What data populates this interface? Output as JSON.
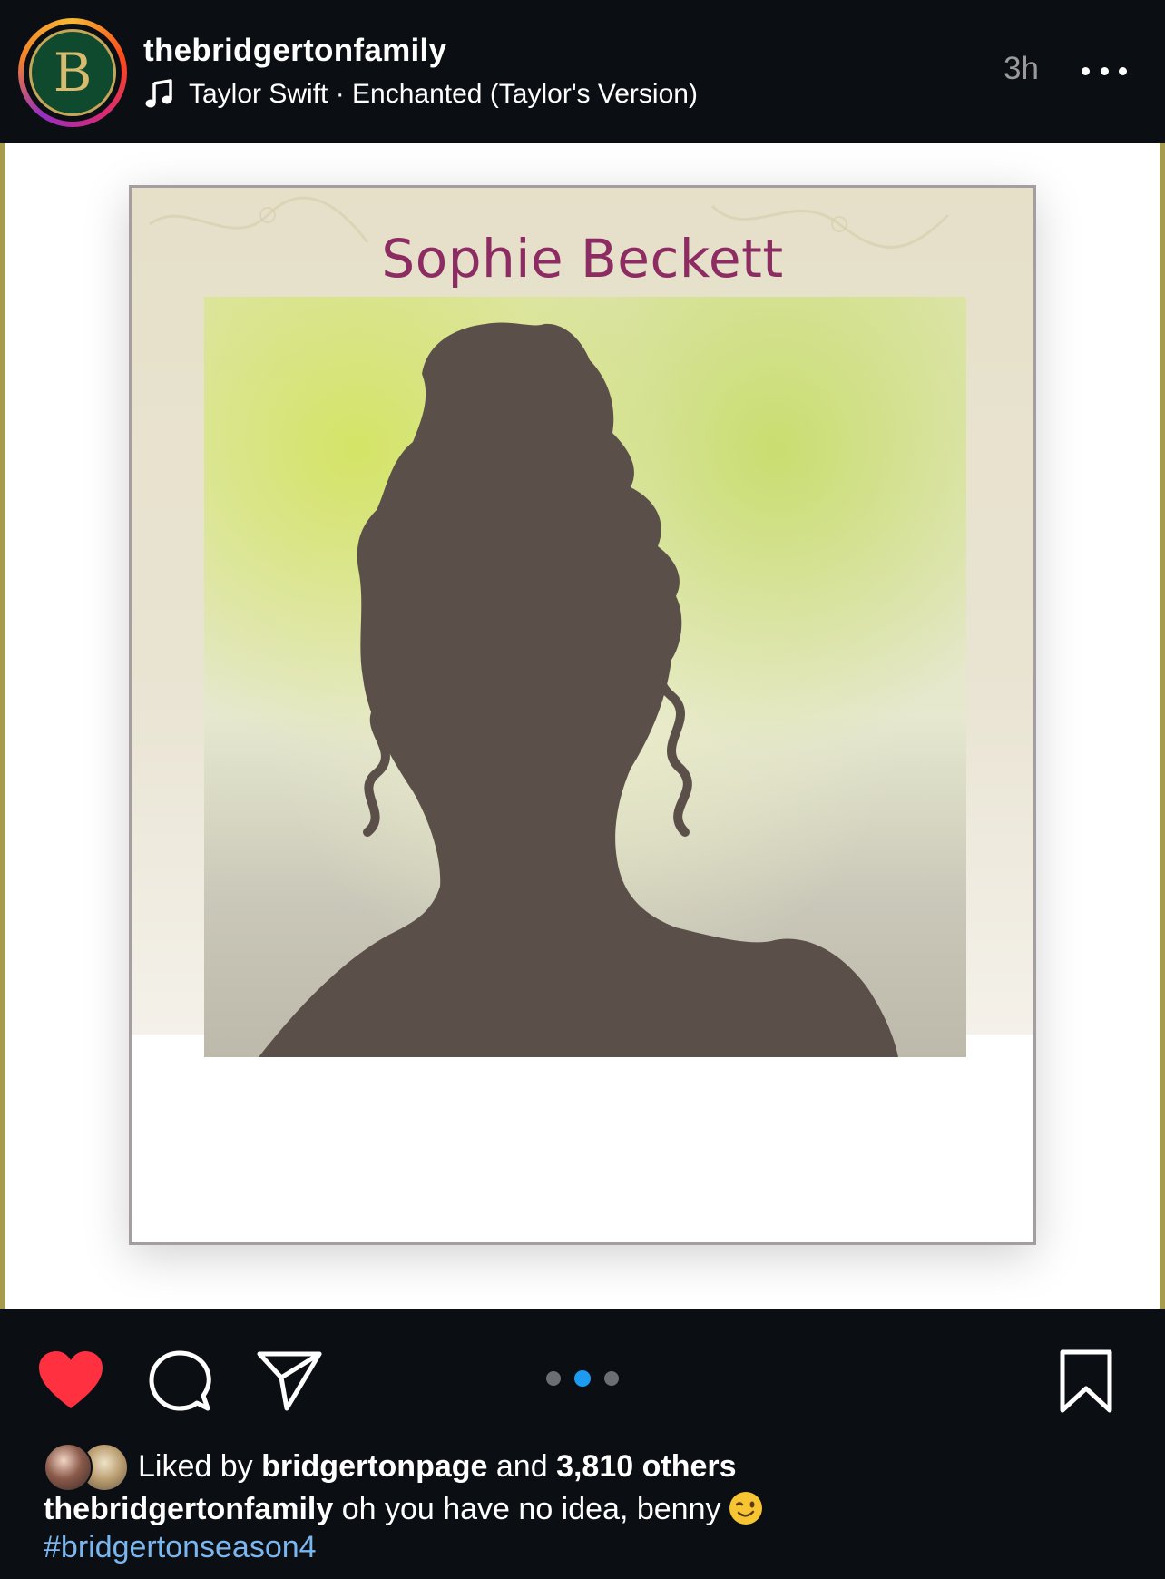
{
  "post": {
    "username": "thebridgertonfamily",
    "avatar_letter": "B",
    "song": "Taylor Swift · Enchanted (Taylor's Version)",
    "time": "3h"
  },
  "media": {
    "title": "Sophie Beckett",
    "carousel": {
      "count": 3,
      "active_index": 1
    }
  },
  "likes": {
    "prefix": "Liked by",
    "user": "bridgertonpage",
    "and": "and",
    "others": "3,810 others"
  },
  "caption": {
    "username": "thebridgertonfamily",
    "text": "oh you have no idea, benny",
    "hashtag": "#bridgertonseason4"
  },
  "icons": {
    "more": "more-options-icon",
    "music": "music-note-icon",
    "mute": "muted-speaker-icon",
    "like": "heart-icon",
    "comment": "comment-icon",
    "share": "send-icon",
    "save": "bookmark-icon"
  },
  "colors": {
    "background": "#0b0f14",
    "liked_heart": "#ff3040",
    "active_dot": "#1d9bf0",
    "hashtag": "#7ab6ef",
    "title_text": "#8c2c63"
  }
}
